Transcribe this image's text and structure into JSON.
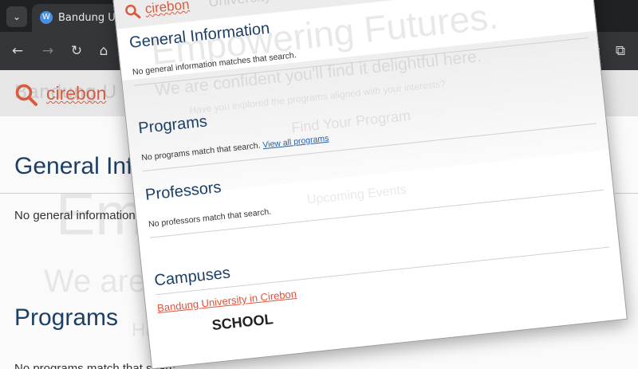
{
  "browser": {
    "tab_title": "Bandung Uni",
    "menu_icon": "chevron-down-icon",
    "globe_icon": "wordpress-icon"
  },
  "background_page": {
    "search_query": "cirebon",
    "ghost_site_name": "Bandung U",
    "heading_general": "General Info",
    "text_general": "No general information m",
    "heading_programs": "Programs",
    "text_programs": "No programs match that searc",
    "hero_line1": "Em",
    "hero_line2": "We are c",
    "hero_line3": "Have"
  },
  "overlay": {
    "search_query": "cirebon",
    "ghost_text": "University",
    "general_heading": "General Information",
    "general_text": "No general information matches that search.",
    "programs_heading": "Programs",
    "programs_text": "No programs match that search.",
    "programs_link": "View all programs",
    "professors_heading": "Professors",
    "professors_text": "No professors match that search.",
    "campuses_heading": "Campuses",
    "campus_link": "Bandung University in Cirebon",
    "bottom_text": "SCHOOL",
    "ghost_hero1": "Empowering Futures.",
    "ghost_hero2": "We are confident you'll find it delightful here.",
    "ghost_hero3": "Have you explored the programs aligned with your interests?",
    "ghost_button": "Find Your Program",
    "ghost_events": "Upcoming Events"
  },
  "colors": {
    "heading": "#1d3f66",
    "accent": "#d95b3e",
    "link": "#1f5fa8"
  }
}
